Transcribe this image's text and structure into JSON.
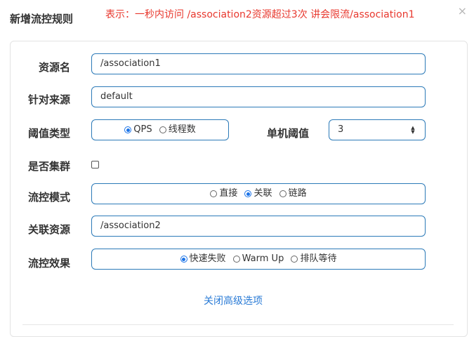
{
  "dialog": {
    "title": "新增流控规则",
    "annotation": "表示：一秒内访问 /association2资源超过3次  讲会限流/association1",
    "close_icon": "×"
  },
  "form": {
    "resource_name": {
      "label": "资源名",
      "value": "/association1"
    },
    "origin": {
      "label": "针对来源",
      "value": "default"
    },
    "threshold_type": {
      "label": "阈值类型",
      "options": [
        {
          "label": "QPS",
          "selected": true
        },
        {
          "label": "线程数",
          "selected": false
        }
      ]
    },
    "single_threshold": {
      "label": "单机阈值",
      "value": "3"
    },
    "cluster": {
      "label": "是否集群",
      "checked": false
    },
    "flow_mode": {
      "label": "流控模式",
      "options": [
        {
          "label": "直接",
          "selected": false
        },
        {
          "label": "关联",
          "selected": true
        },
        {
          "label": "链路",
          "selected": false
        }
      ]
    },
    "related_resource": {
      "label": "关联资源",
      "value": "/association2"
    },
    "control_effect": {
      "label": "流控效果",
      "options": [
        {
          "label": "快速失败",
          "selected": true
        },
        {
          "label": "Warm Up",
          "selected": false
        },
        {
          "label": "排队等待",
          "selected": false
        }
      ]
    },
    "advanced_toggle": "关闭高级选项"
  },
  "colors": {
    "annotation": "#e8382e",
    "input_border": "#2c7ab8",
    "link": "#2a7bd6",
    "radio_selected": "#1a73e8"
  }
}
